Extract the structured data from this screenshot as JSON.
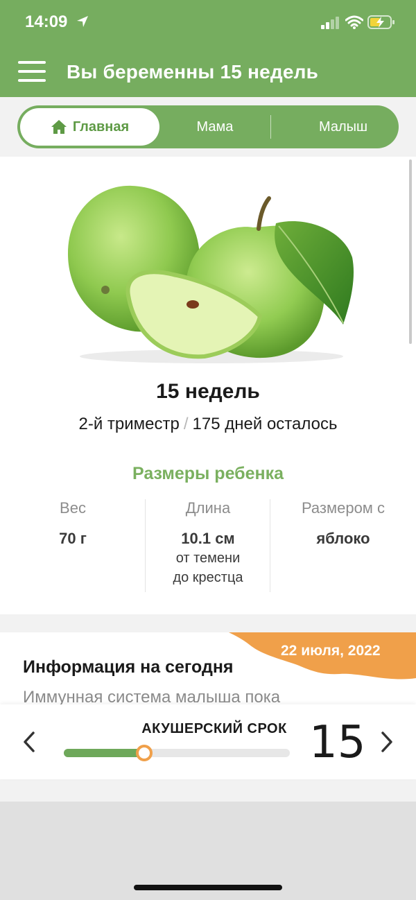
{
  "status": {
    "time": "14:09"
  },
  "header": {
    "title": "Вы беременны 15 недель"
  },
  "tabs": {
    "home": "Главная",
    "mama": "Мама",
    "baby": "Малыш"
  },
  "week_card": {
    "weeks": "15 недель",
    "trimester": "2-й триместр",
    "separator": "/",
    "days_left": "175 дней осталось"
  },
  "sizes": {
    "title": "Размеры ребенка",
    "weight_label": "Вес",
    "weight_value": "70 г",
    "length_label": "Длина",
    "length_value": "10.1 см",
    "length_sub_1": "от темени",
    "length_sub_2": "до крестца",
    "size_label": "Размером с",
    "size_value": "яблоко"
  },
  "info": {
    "date": "22 июля, 2022",
    "title": "Информация на сегодня",
    "text": "Иммунная система малыша пока"
  },
  "weekbar": {
    "label": "АКУШЕРСКИЙ СРОК",
    "week": "15",
    "progress": 0.355
  },
  "colors": {
    "accent": "#76ad5f",
    "orange": "#f0a04a"
  }
}
